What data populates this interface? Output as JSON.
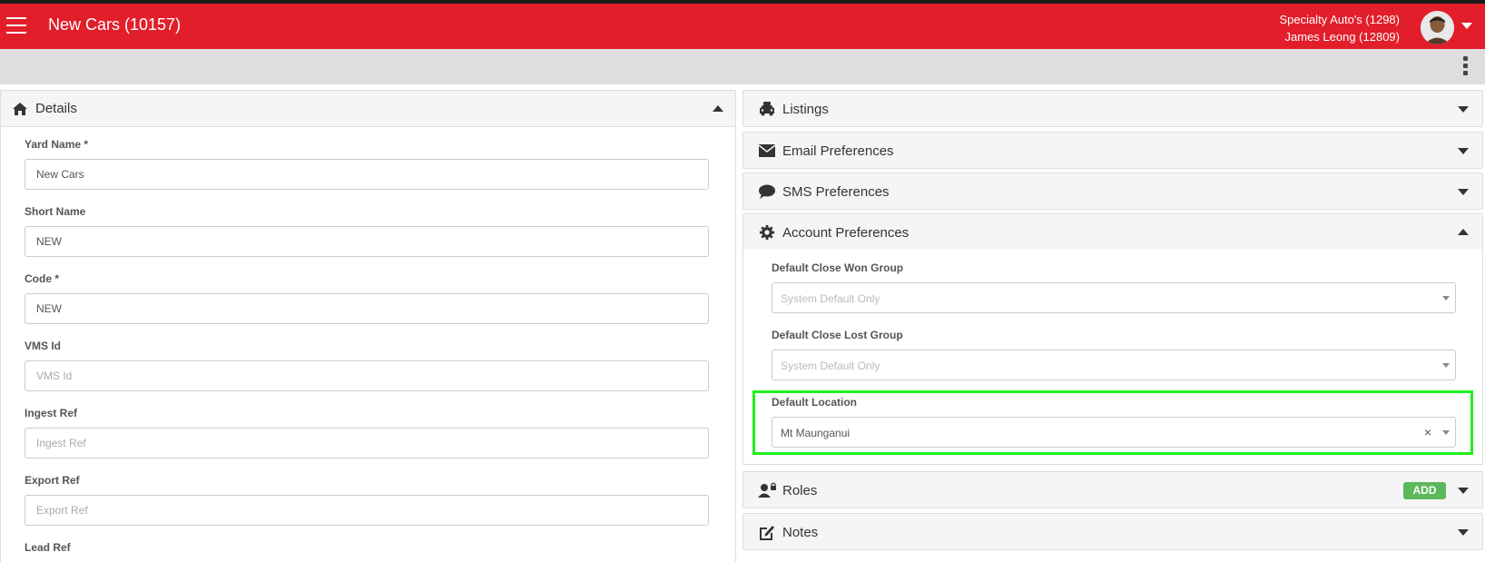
{
  "header": {
    "title": "New Cars (10157)",
    "account_line1": "Specialty Auto's (1298)",
    "account_line2": "James Leong (12809)",
    "brand_color": "#e21e2b"
  },
  "details": {
    "title": "Details",
    "fields": [
      {
        "label": "Yard Name *",
        "value": "New Cars",
        "placeholder": ""
      },
      {
        "label": "Short Name",
        "value": "NEW",
        "placeholder": ""
      },
      {
        "label": "Code *",
        "value": "NEW",
        "placeholder": ""
      },
      {
        "label": "VMS Id",
        "value": "",
        "placeholder": "VMS Id"
      },
      {
        "label": "Ingest Ref",
        "value": "",
        "placeholder": "Ingest Ref"
      },
      {
        "label": "Export Ref",
        "value": "",
        "placeholder": "Export Ref"
      },
      {
        "label": "Lead Ref",
        "value": "",
        "placeholder": ""
      }
    ]
  },
  "accordions": {
    "listings": "Listings",
    "email": "Email Preferences",
    "sms": "SMS Preferences",
    "account": "Account Preferences",
    "roles": "Roles",
    "roles_add": "ADD",
    "notes": "Notes"
  },
  "account_prefs": {
    "close_won_label": "Default Close Won Group",
    "close_won_value": "System Default Only",
    "close_lost_label": "Default Close Lost Group",
    "close_lost_value": "System Default Only",
    "location_label": "Default Location",
    "location_value": "Mt Maunganui",
    "clear_glyph": "×"
  },
  "icons": {
    "menu": "hamburger-icon",
    "more": "kebab-icon",
    "home": "home-icon",
    "car": "car-icon",
    "envelope": "envelope-icon",
    "chat": "chat-bubble-icon",
    "gear": "gear-icon",
    "user_lock": "user-lock-icon",
    "edit": "edit-note-icon"
  }
}
